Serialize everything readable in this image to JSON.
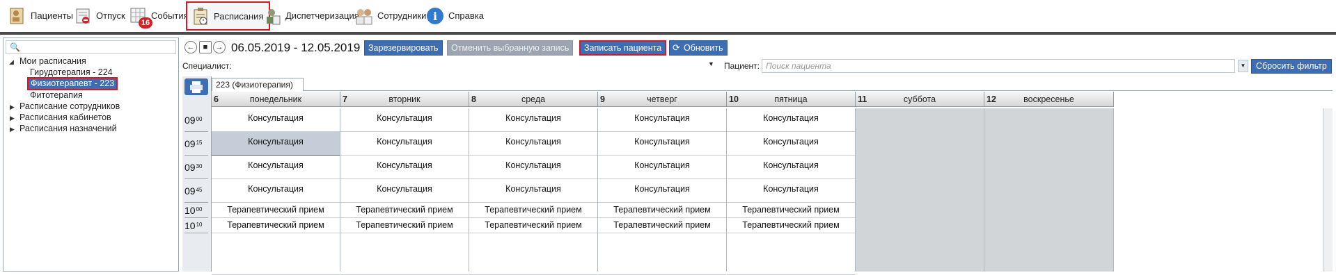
{
  "menu": {
    "patients": "Пациенты",
    "vacation": "Отпуск",
    "events": "События",
    "events_badge": "16",
    "schedules": "Расписания",
    "dispensary": "Диспетчеризация",
    "staff": "Сотрудники",
    "help": "Справка"
  },
  "tree": {
    "search_placeholder": "",
    "my_schedules": "Мои расписания",
    "children": [
      "Гирудотерапия - 224",
      "Физиотерапевт - 223",
      "Фитотерапия"
    ],
    "staff_schedules": "Расписание сотрудников",
    "room_schedules": "Расписания кабинетов",
    "appointment_schedules": "Расписания назначений"
  },
  "toolbar": {
    "date_range": "06.05.2019 - 12.05.2019",
    "reserve": "Зарезервировать",
    "cancel": "Отменить выбранную запись",
    "book_patient": "Записать пациента",
    "refresh": "Обновить"
  },
  "filter": {
    "specialist_label": "Специалист:",
    "patient_label": "Пациент:",
    "patient_placeholder": "Поиск пациента",
    "reset": "Сбросить фильтр"
  },
  "schedule": {
    "tab": "223 (Физиотерапия)",
    "days": [
      {
        "num": "6",
        "name": "понедельник"
      },
      {
        "num": "7",
        "name": "вторник"
      },
      {
        "num": "8",
        "name": "среда"
      },
      {
        "num": "9",
        "name": "четверг"
      },
      {
        "num": "10",
        "name": "пятница"
      },
      {
        "num": "11",
        "name": "суббота"
      },
      {
        "num": "12",
        "name": "воскресенье"
      }
    ],
    "times": [
      {
        "h": "09",
        "m": "00"
      },
      {
        "h": "09",
        "m": "15"
      },
      {
        "h": "09",
        "m": "30"
      },
      {
        "h": "09",
        "m": "45"
      },
      {
        "h": "10",
        "m": "00"
      },
      {
        "h": "10",
        "m": "10"
      }
    ],
    "slot_consult": "Консультация",
    "slot_therapy": "Терапевтический прием"
  },
  "colors": {
    "accent": "#3d6eb5",
    "highlight_border": "#e0141e",
    "weekend": "#d2d5d8"
  }
}
